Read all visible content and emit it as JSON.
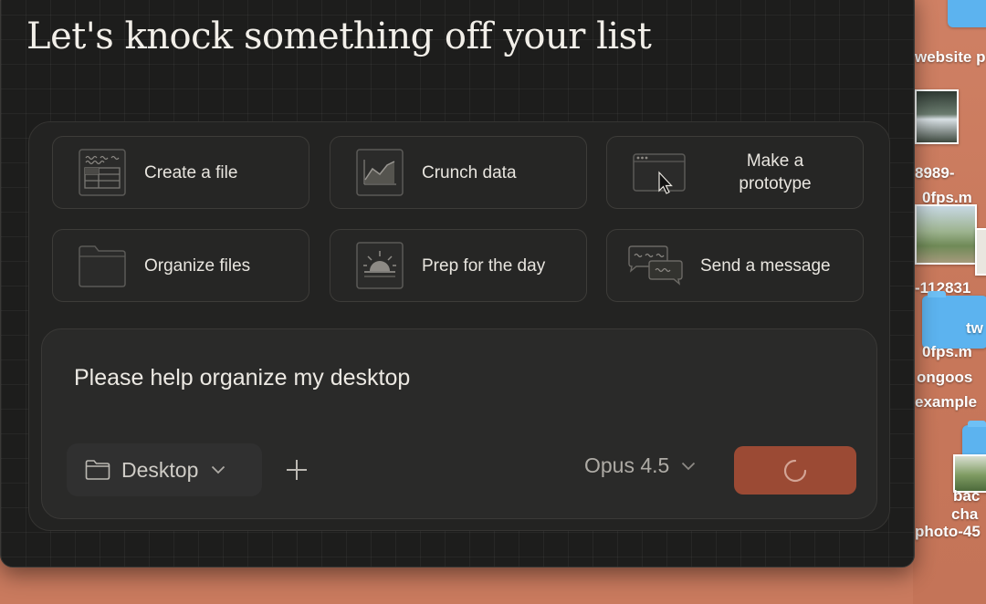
{
  "headline": "Let's knock something off your list",
  "cards": [
    {
      "label": "Create a file",
      "icon": "spreadsheet-icon"
    },
    {
      "label": "Crunch data",
      "icon": "chart-icon"
    },
    {
      "label": "Make a\nprototype",
      "icon": "browser-window-icon"
    },
    {
      "label": "Organize files",
      "icon": "folder-icon"
    },
    {
      "label": "Prep for the day",
      "icon": "sunrise-icon"
    },
    {
      "label": "Send a message",
      "icon": "chat-bubbles-icon"
    }
  ],
  "composer": {
    "prompt_text": "Please help organize my desktop",
    "folder_label": "Desktop",
    "model_label": "Opus 4.5"
  },
  "desktop": {
    "labels": [
      "website p",
      "8989-",
      "0fps.m",
      "-112831",
      "tw",
      "0fps.m",
      "ongoos",
      "example",
      "bac",
      "cha",
      "photo-45"
    ]
  },
  "colors": {
    "accent": "#9b4a34",
    "window_bg": "#1d1d1c",
    "desktop_bg": "#c97a5e"
  }
}
